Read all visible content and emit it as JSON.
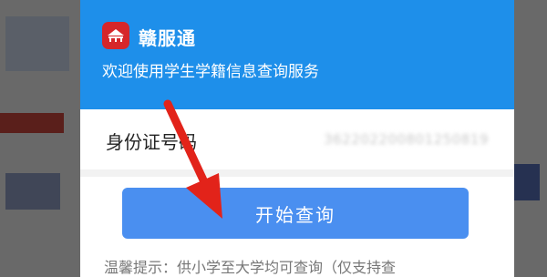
{
  "app": {
    "name": "赣服通",
    "welcome": "欢迎使用学生学籍信息查询服务",
    "logo_icon": "ganfutong-logo-icon"
  },
  "form": {
    "id_label": "身份证号码",
    "id_value": "362202200801250819"
  },
  "actions": {
    "start_query_label": "开始查询"
  },
  "tip": {
    "text": "温馨提示：供小学至大学均可查询（仅支持查"
  },
  "colors": {
    "header_blue": "#1e8fea",
    "button_blue": "#4a8ff0",
    "logo_red": "#d6262a",
    "arrow_red": "#e2231a"
  }
}
